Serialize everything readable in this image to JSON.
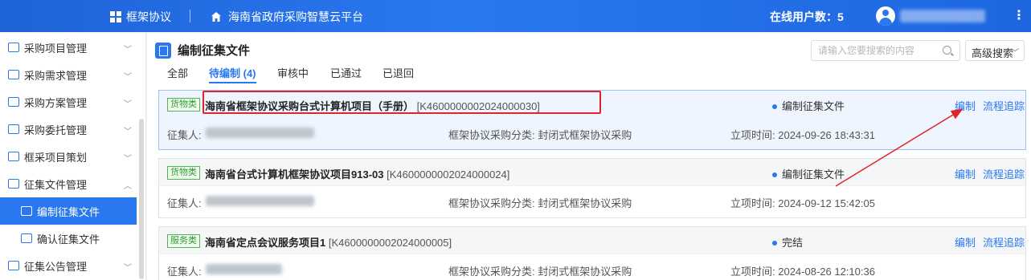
{
  "header": {
    "brand": "框架协议",
    "platform": "海南省政府采购智慧云平台",
    "online_users": "在线用户数：5"
  },
  "sidebar": {
    "items": [
      {
        "label": "采购项目管理"
      },
      {
        "label": "采购需求管理"
      },
      {
        "label": "采购方案管理"
      },
      {
        "label": "采购委托管理"
      },
      {
        "label": "框采项目策划"
      },
      {
        "label": "征集文件管理"
      },
      {
        "label": "编制征集文件"
      },
      {
        "label": "确认征集文件"
      },
      {
        "label": "征集公告管理"
      }
    ]
  },
  "main": {
    "title": "编制征集文件",
    "search_placeholder": "请输入您要搜索的内容",
    "advanced_search": "高级搜索",
    "tabs": [
      {
        "label": "全部"
      },
      {
        "label": "待编制 (4)"
      },
      {
        "label": "审核中"
      },
      {
        "label": "已通过"
      },
      {
        "label": "已退回"
      }
    ],
    "labels": {
      "collector": "征集人:",
      "category": "框架协议采购分类: ",
      "time": "立项时间: ",
      "edit": "编制",
      "track": "流程追踪"
    },
    "projects": [
      {
        "tag": "货物类",
        "name": "海南省框架协议采购台式计算机项目（手册）",
        "code": "[K4600000002024000030]",
        "status": "编制征集文件",
        "category": "封闭式框架协议采购",
        "time": "2024-09-26 18:43:31"
      },
      {
        "tag": "货物类",
        "name": "海南省台式计算机框架协议项目913-03",
        "code": "[K4600000002024000024]",
        "status": "编制征集文件",
        "category": "封闭式框架协议采购",
        "time": "2024-09-12 15:42:05"
      },
      {
        "tag": "服务类",
        "name": "海南省定点会议服务项目1",
        "code": "[K4600000002024000005]",
        "status": "完结",
        "category": "封闭式框架协议采购",
        "time": "2024-08-26 12:10:36"
      }
    ]
  },
  "colors": {
    "primary": "#2a78f0",
    "tag_green": "#2e9c2e",
    "highlight_red": "#e0242a"
  }
}
